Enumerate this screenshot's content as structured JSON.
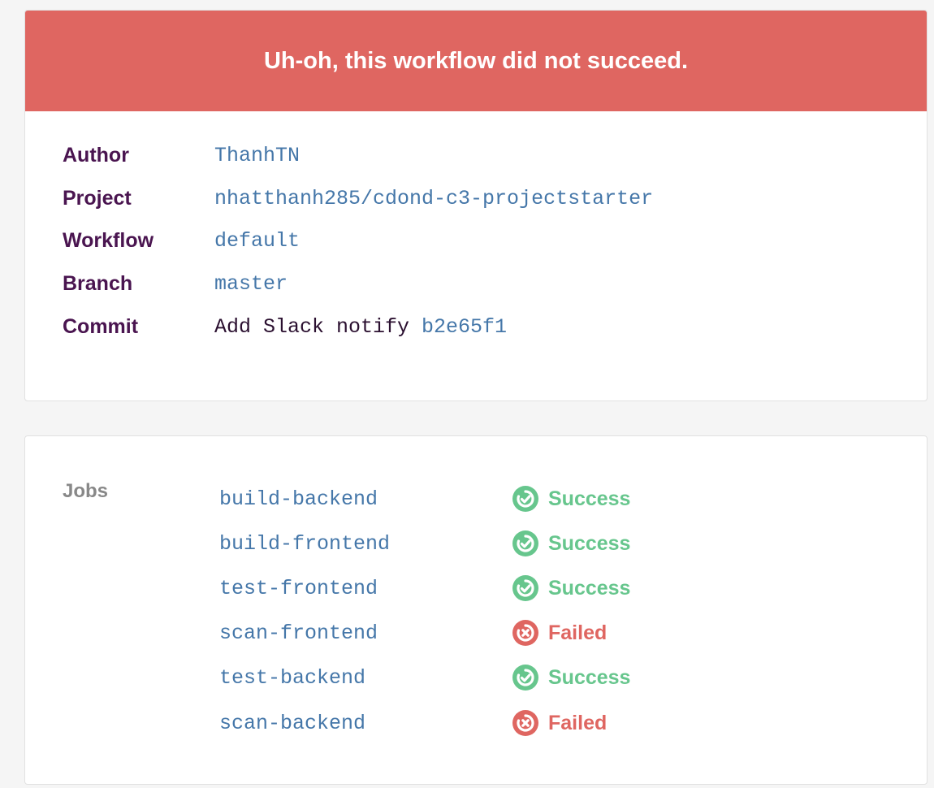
{
  "banner": {
    "title": "Uh-oh, this workflow did not succeed."
  },
  "details": [
    {
      "label": "Author",
      "value": "ThanhTN"
    },
    {
      "label": "Project",
      "value": "nhatthanh285/cdond-c3-projectstarter"
    },
    {
      "label": "Workflow",
      "value": "default"
    },
    {
      "label": "Branch",
      "value": "master"
    },
    {
      "label": "Commit",
      "message": "Add Slack notify ",
      "hash": "b2e65f1"
    }
  ],
  "jobs": {
    "title": "Jobs",
    "items": [
      {
        "name": "build-backend",
        "status": "Success",
        "icon": "check-circle-icon"
      },
      {
        "name": "build-frontend",
        "status": "Success",
        "icon": "check-circle-icon"
      },
      {
        "name": "test-frontend",
        "status": "Success",
        "icon": "check-circle-icon"
      },
      {
        "name": "scan-frontend",
        "status": "Failed",
        "icon": "x-circle-icon"
      },
      {
        "name": "test-backend",
        "status": "Success",
        "icon": "check-circle-icon"
      },
      {
        "name": "scan-backend",
        "status": "Failed",
        "icon": "x-circle-icon"
      }
    ]
  },
  "colors": {
    "banner": "#df6661",
    "label": "#4a1550",
    "link": "#4577a9",
    "success": "#67c68d",
    "failed": "#df6661"
  }
}
